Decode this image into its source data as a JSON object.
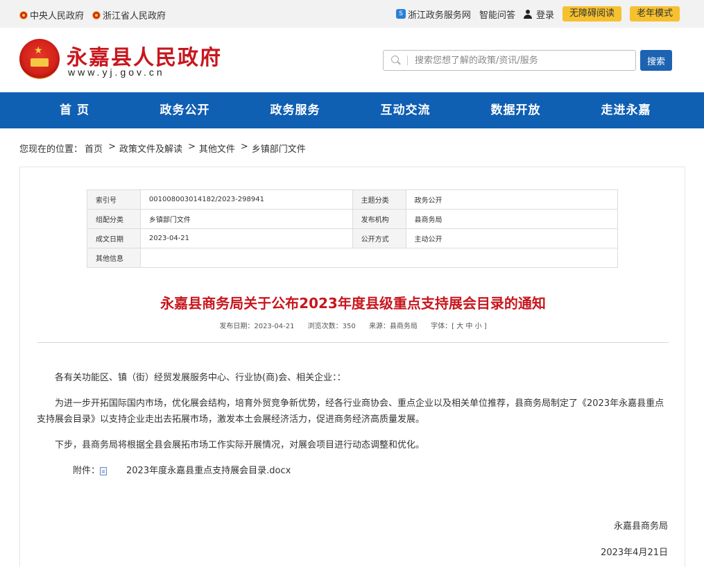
{
  "topbar": {
    "links_left": [
      "中央人民政府",
      "浙江省人民政府"
    ],
    "zj_service": "浙江政务服务网",
    "zj_icon_glyph": "S",
    "smart_qa": "智能问答",
    "login": "登录",
    "accessible": "无障碍阅读",
    "elder": "老年模式"
  },
  "header": {
    "title": "永嘉县人民政府",
    "url": "www.yj.gov.cn",
    "emblem_star": "★",
    "search_placeholder": "搜索您想了解的政策/资讯/服务",
    "search_button": "搜索"
  },
  "nav": [
    "首 页",
    "政务公开",
    "政务服务",
    "互动交流",
    "数据开放",
    "走进永嘉"
  ],
  "breadcrumb": {
    "prefix": "您现在的位置：",
    "items": [
      "首页",
      "政策文件及解读",
      "其他文件",
      "乡镇部门文件"
    ],
    "sep": ">"
  },
  "info": {
    "rows": [
      {
        "k1": "索引号",
        "v1": "001008003014182/2023-298941",
        "k2": "主题分类",
        "v2": "政务公开"
      },
      {
        "k1": "组配分类",
        "v1": "乡镇部门文件",
        "k2": "发布机构",
        "v2": "县商务局"
      },
      {
        "k1": "成文日期",
        "v1": "2023-04-21",
        "k2": "公开方式",
        "v2": "主动公开"
      },
      {
        "k1": "其他信息",
        "v1": ""
      }
    ]
  },
  "article": {
    "title": "永嘉县商务局关于公布2023年度县级重点支持展会目录的通知",
    "meta": {
      "date": "发布日期：2023-04-21",
      "views": "浏览次数：350",
      "source": "来源：县商务局",
      "font": "字体：[ 大 中 小 ]"
    },
    "paragraphs": [
      "各有关功能区、镇（街）经贸发展服务中心、行业协(商)会、相关企业：：",
      "为进一步开拓国际国内市场，优化展会结构，培育外贸竞争新优势，经各行业商协会、重点企业以及相关单位推荐，县商务局制定了《2023年永嘉县重点支持展会目录》以支持企业走出去拓展市场，激发本土会展经济活力，促进商务经济高质量发展。",
      "下步，县商务局将根据全县会展拓市场工作实际开展情况，对展会项目进行动态调整和优化。"
    ],
    "attachment_label": "附件：",
    "attachment_file": "2023年度永嘉县重点支持展会目录.docx",
    "signer": "永嘉县商务局",
    "sign_date": "2023年4月21日"
  }
}
